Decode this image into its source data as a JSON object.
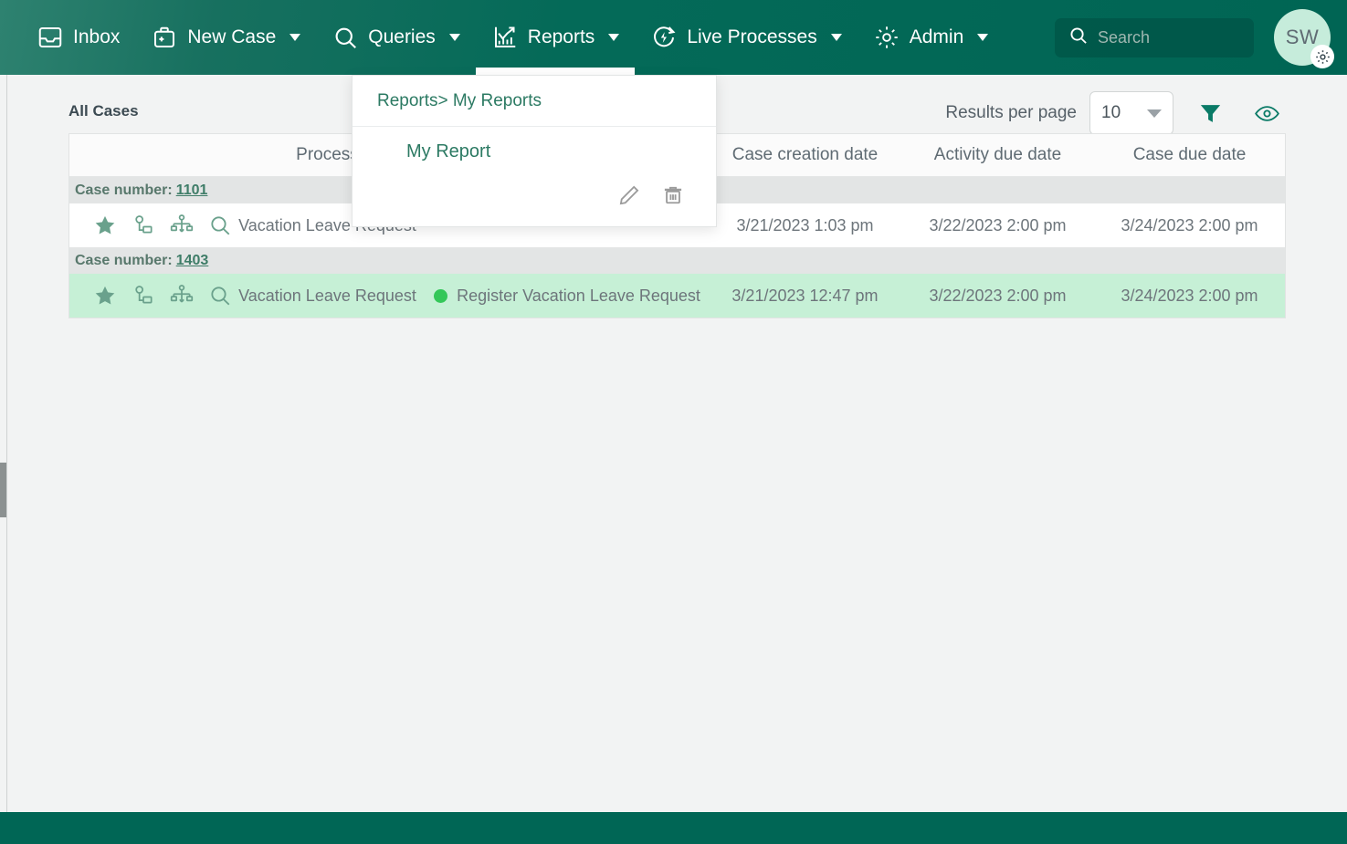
{
  "nav": {
    "items": [
      {
        "label": "Inbox",
        "icon": "inbox-icon",
        "caret": false,
        "active": false
      },
      {
        "label": "New Case",
        "icon": "briefcase-plus-icon",
        "caret": true,
        "active": false
      },
      {
        "label": "Queries",
        "icon": "search-icon",
        "caret": true,
        "active": false
      },
      {
        "label": "Reports",
        "icon": "chart-trend-icon",
        "caret": true,
        "active": true
      },
      {
        "label": "Live Processes",
        "icon": "refresh-bolt-icon",
        "caret": true,
        "active": false
      },
      {
        "label": "Admin",
        "icon": "gear-icon",
        "caret": true,
        "active": false
      }
    ],
    "search": {
      "placeholder": "Search",
      "icon": "search-icon"
    },
    "avatar": {
      "initials": "SW",
      "badge_icon": "gear-icon"
    }
  },
  "dropdown": {
    "breadcrumb": "Reports> My Reports",
    "item_label": "My Report",
    "edit_icon": "pencil-icon",
    "delete_icon": "trash-icon"
  },
  "page": {
    "title": "All Cases"
  },
  "toolbar": {
    "results_per_page_label": "Results per page",
    "results_per_page_value": "10",
    "filter_icon": "filter-icon",
    "visibility_icon": "eye-icon"
  },
  "table": {
    "columns": [
      {
        "key": "actions",
        "label": ""
      },
      {
        "key": "process",
        "label": "Process"
      },
      {
        "key": "activity",
        "label": ""
      },
      {
        "key": "created",
        "label": "Case creation date"
      },
      {
        "key": "act_due",
        "label": "Activity due date"
      },
      {
        "key": "case_due",
        "label": "Case due date"
      }
    ],
    "group_label": "Case number:",
    "row_icons": [
      {
        "name": "star-icon"
      },
      {
        "name": "assign-icon"
      },
      {
        "name": "process-tree-icon"
      },
      {
        "name": "search-icon"
      }
    ],
    "groups": [
      {
        "case_number": "1101",
        "selected": false,
        "row": {
          "process": "Vacation Leave Request",
          "activity": "",
          "created": "3/21/2023 1:03 pm",
          "act_due": "3/22/2023 2:00 pm",
          "case_due": "3/24/2023 2:00 pm",
          "status_color": "#34c759"
        }
      },
      {
        "case_number": "1403",
        "selected": true,
        "row": {
          "process": "Vacation Leave Request",
          "activity": "Register Vacation Leave Request",
          "created": "3/21/2023 12:47 pm",
          "act_due": "3/22/2023 2:00 pm",
          "case_due": "3/24/2023 2:00 pm",
          "status_color": "#34c759"
        }
      }
    ]
  },
  "colors": {
    "brand": "#006655",
    "accent": "#2c7a63",
    "selected_row": "#c6f0d6",
    "status_green": "#34c759"
  }
}
